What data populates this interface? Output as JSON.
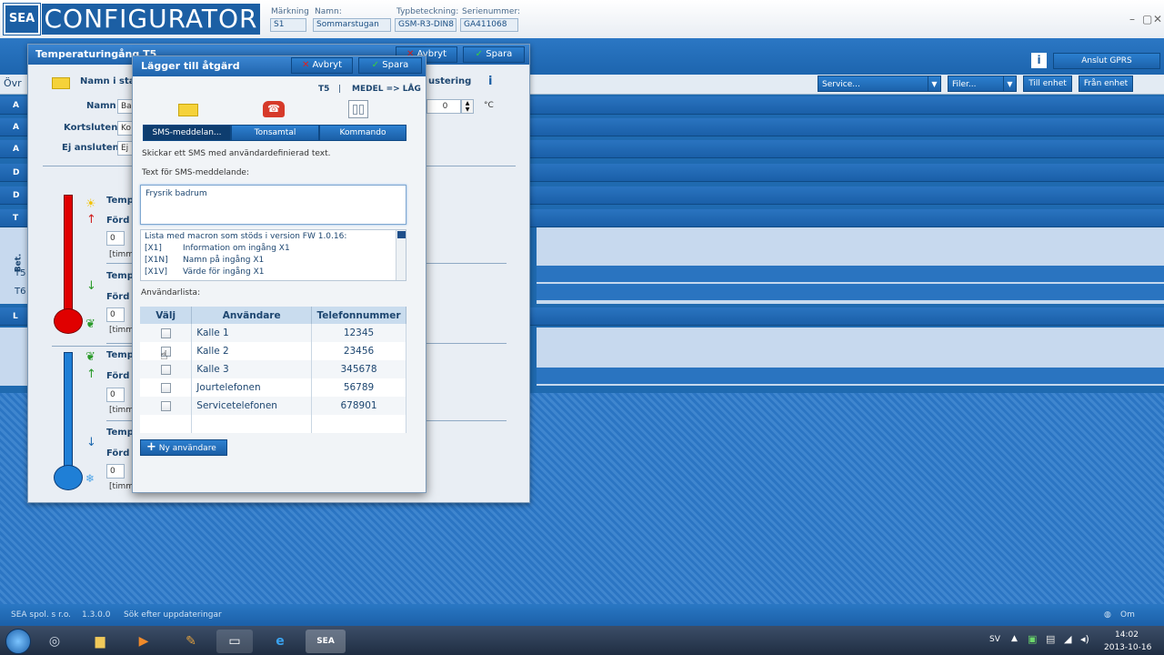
{
  "header": {
    "logo_mark": "SEA",
    "app_title": "CONFIGURATOR",
    "fields": [
      {
        "label": "Märkning",
        "value": "S1"
      },
      {
        "label": "Namn:",
        "value": "Sommarstugan"
      },
      {
        "label": "Typbeteckning:",
        "value": "GSM-R3-DIN8"
      },
      {
        "label": "Serienummer:",
        "value": "GA411068"
      }
    ],
    "window_controls": [
      "–",
      "▢",
      "✕"
    ]
  },
  "toolbar": {
    "service_select": "Service...",
    "files_select": "Filer...",
    "to_unit": "Till enhet",
    "from_unit": "Från enhet",
    "connect_gprs": "Anslut GPRS",
    "info_icon": "info-icon",
    "left_label": "Övr"
  },
  "back_dialog": {
    "title": "Temperaturingång T5",
    "cancel": "Avbryt",
    "save": "Spara",
    "name_state_label": "Namn i sta",
    "adjust_label": "ustering",
    "name_label": "Namn",
    "name_value": "Ba",
    "shorted_label": "Kortsluten",
    "shorted_value": "Ko",
    "not_connected_label": "Ej ansluten",
    "not_connected_value": "Ej",
    "offset_value": "0",
    "unit": "°C",
    "temp_labels": [
      "Temp",
      "Temp",
      "Temp",
      "Temp"
    ],
    "delay_labels": [
      "Förd",
      "Förd",
      "Förd",
      "Förd"
    ],
    "spin_values": [
      "0",
      "0",
      "0",
      "0"
    ],
    "timer_labels": [
      "[timm",
      "[timm",
      "[timm",
      "[timm"
    ]
  },
  "background": {
    "side_letters": [
      "A",
      "A",
      "A",
      "D",
      "D",
      "T",
      "Bet.",
      "T5",
      "T6",
      "L"
    ]
  },
  "front_dialog": {
    "title": "Lägger till åtgärd",
    "cancel": "Avbryt",
    "save": "Spara",
    "input_ref": "T5",
    "separator": "|",
    "transition": "MEDEL => LÅG",
    "tabs": [
      "SMS-meddelan...",
      "Tonsamtal",
      "Kommando"
    ],
    "selected_tab": 0,
    "description": "Skickar ett SMS med användardefinierad text.",
    "sms_label": "Text för SMS-meddelande:",
    "sms_text": "Frysrik badrum",
    "macro_header": "Lista med macron som stöds i version FW 1.0.16:",
    "macros": [
      {
        "code": "[X1]",
        "desc": "Information om ingång X1"
      },
      {
        "code": "[X1N]",
        "desc": "Namn på ingång X1"
      },
      {
        "code": "[X1V]",
        "desc": "Värde för ingång X1"
      }
    ],
    "user_list_label": "Användarlista:",
    "columns": [
      "Välj",
      "Användare",
      "Telefonnummer"
    ],
    "users": [
      {
        "name": "Kalle 1",
        "phone": "12345"
      },
      {
        "name": "Kalle 2",
        "phone": "23456"
      },
      {
        "name": "Kalle 3",
        "phone": "345678"
      },
      {
        "name": "Jourtelefonen",
        "phone": "56789"
      },
      {
        "name": "Servicetelefonen",
        "phone": "678901"
      }
    ],
    "new_user": "Ny användare"
  },
  "status": {
    "company": "SEA spol. s r.o.",
    "version": "1.3.0.0",
    "updates": "Sök efter uppdateringar",
    "about": "Om"
  },
  "taskbar": {
    "language": "SV",
    "time": "14:02",
    "date": "2013-10-16"
  },
  "colors": {
    "accent": "#1f63ab",
    "thermo_red": "#e00000",
    "thermo_blue": "#1f7fd6"
  }
}
